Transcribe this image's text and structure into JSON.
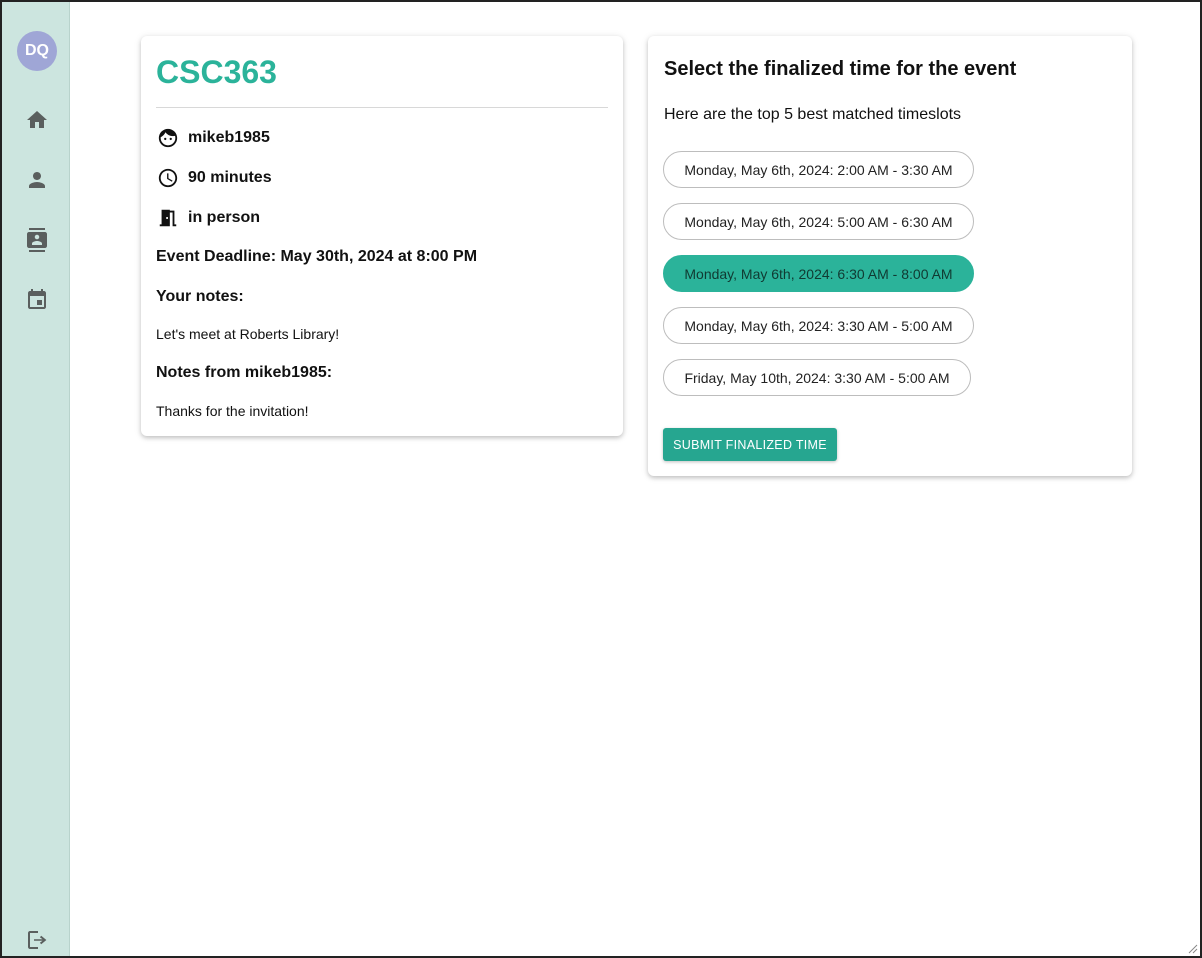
{
  "sidebar": {
    "avatar_initials": "DQ",
    "avatar_color": "#9fa6d6",
    "items": [
      {
        "name": "home",
        "icon": "home-icon"
      },
      {
        "name": "profile",
        "icon": "person-icon"
      },
      {
        "name": "contacts",
        "icon": "contacts-icon"
      },
      {
        "name": "calendar",
        "icon": "calendar-icon"
      }
    ],
    "logout_icon": "logout-icon"
  },
  "event": {
    "title": "CSC363",
    "owner": "mikeb1985",
    "duration": "90 minutes",
    "location": "in person",
    "deadline": "Event Deadline: May 30th, 2024 at 8:00 PM",
    "your_notes_label": "Your notes:",
    "your_notes": "Let's meet at Roberts Library!",
    "other_notes_label": "Notes from mikeb1985:",
    "other_notes": "Thanks for the invitation!"
  },
  "finalize": {
    "title": "Select the finalized time for the event",
    "subtitle": "Here are the top 5 best matched timeslots",
    "slots": [
      {
        "label": "Monday, May 6th, 2024: 2:00 AM - 3:30 AM",
        "selected": false
      },
      {
        "label": "Monday, May 6th, 2024: 5:00 AM - 6:30 AM",
        "selected": false
      },
      {
        "label": "Monday, May 6th, 2024: 6:30 AM - 8:00 AM",
        "selected": true
      },
      {
        "label": "Monday, May 6th, 2024: 3:30 AM - 5:00 AM",
        "selected": false
      },
      {
        "label": "Friday, May 10th, 2024: 3:30 AM - 5:00 AM",
        "selected": false
      }
    ],
    "submit_label": "SUBMIT FINALIZED TIME"
  },
  "colors": {
    "accent": "#2bb39a",
    "sidebar_bg": "#cce5df"
  }
}
